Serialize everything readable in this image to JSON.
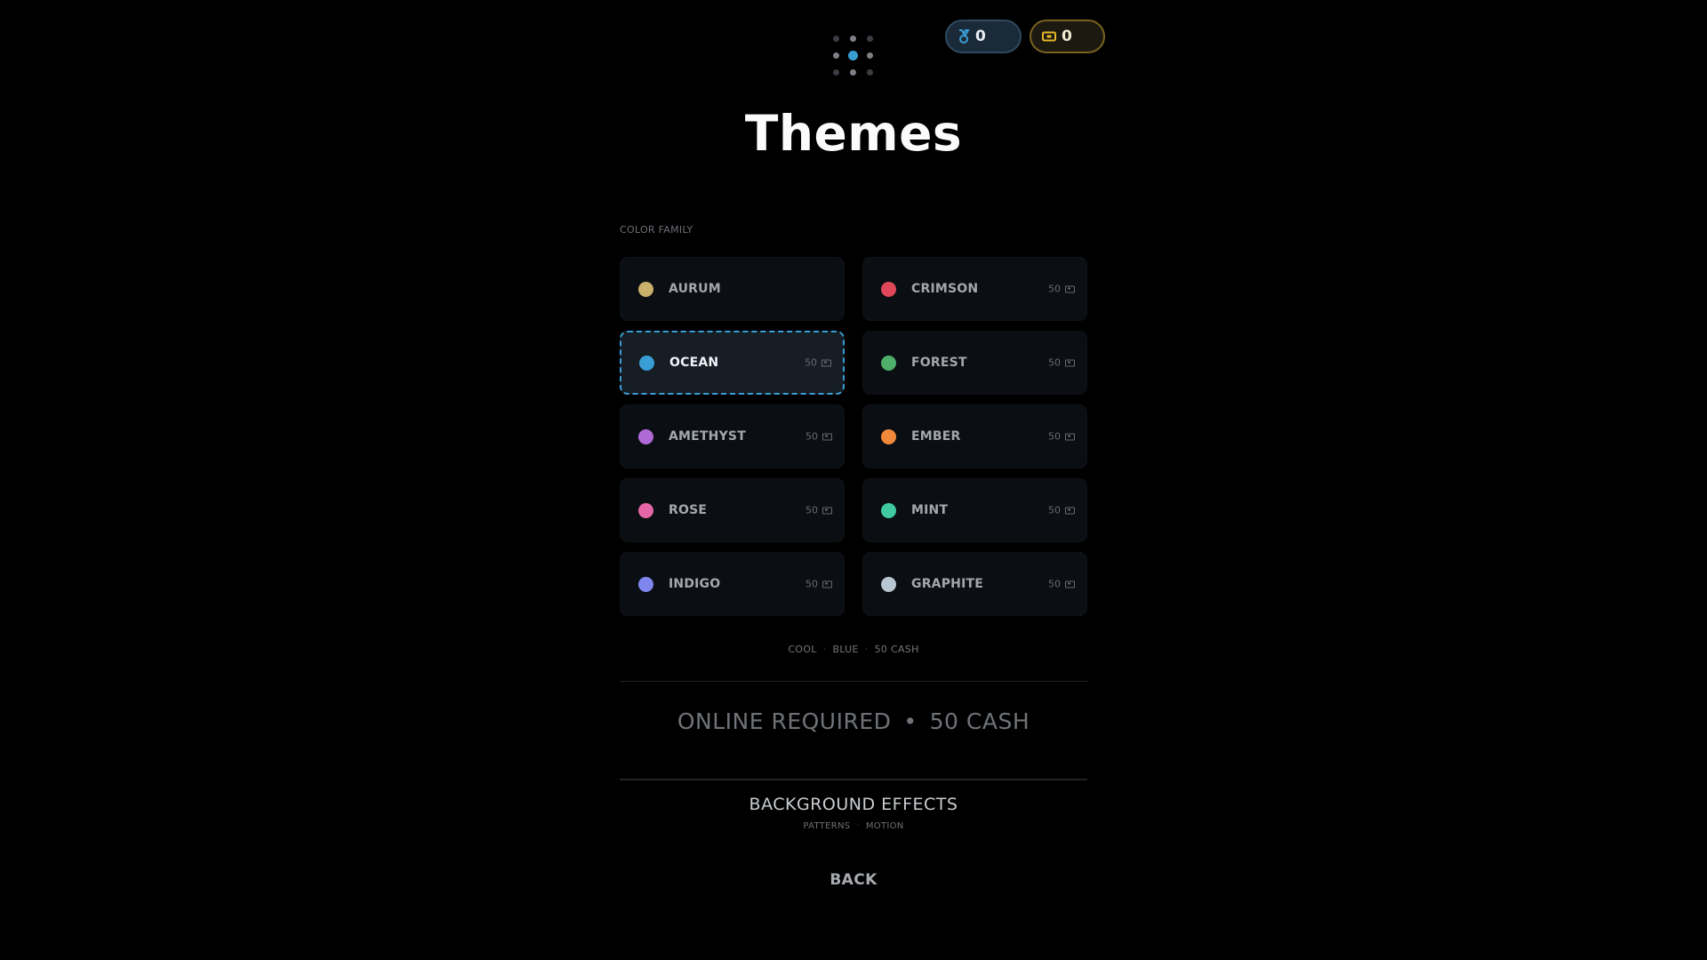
{
  "header": {
    "medals": {
      "value": "0",
      "icon": "medal-icon",
      "color": "#3a9ed6"
    },
    "cash": {
      "value": "0",
      "icon": "cash-icon",
      "color": "#e5b82a"
    }
  },
  "title": "Themes",
  "section_label": "COLOR FAMILY",
  "themes": [
    {
      "name": "AURUM",
      "color": "#c9b06a",
      "price": "",
      "selected": false
    },
    {
      "name": "CRIMSON",
      "color": "#e0485a",
      "price": "50",
      "selected": false
    },
    {
      "name": "OCEAN",
      "color": "#3a9ed6",
      "price": "50",
      "selected": true
    },
    {
      "name": "FOREST",
      "color": "#4fae6a",
      "price": "50",
      "selected": false
    },
    {
      "name": "AMETHYST",
      "color": "#b06ad8",
      "price": "50",
      "selected": false
    },
    {
      "name": "EMBER",
      "color": "#f08a3a",
      "price": "50",
      "selected": false
    },
    {
      "name": "ROSE",
      "color": "#e566a6",
      "price": "50",
      "selected": false
    },
    {
      "name": "MINT",
      "color": "#3fcaa2",
      "price": "50",
      "selected": false
    },
    {
      "name": "INDIGO",
      "color": "#7f86ee",
      "price": "50",
      "selected": false
    },
    {
      "name": "GRAPHITE",
      "color": "#b8c6d2",
      "price": "50",
      "selected": false
    }
  ],
  "tags": [
    "COOL",
    "BLUE",
    "50 CASH"
  ],
  "status": {
    "left": "ONLINE REQUIRED",
    "bullet": "•",
    "right": "50 CASH"
  },
  "background_effects": {
    "title": "BACKGROUND EFFECTS",
    "sub": [
      "PATTERNS",
      "MOTION"
    ]
  },
  "back_label": "BACK"
}
